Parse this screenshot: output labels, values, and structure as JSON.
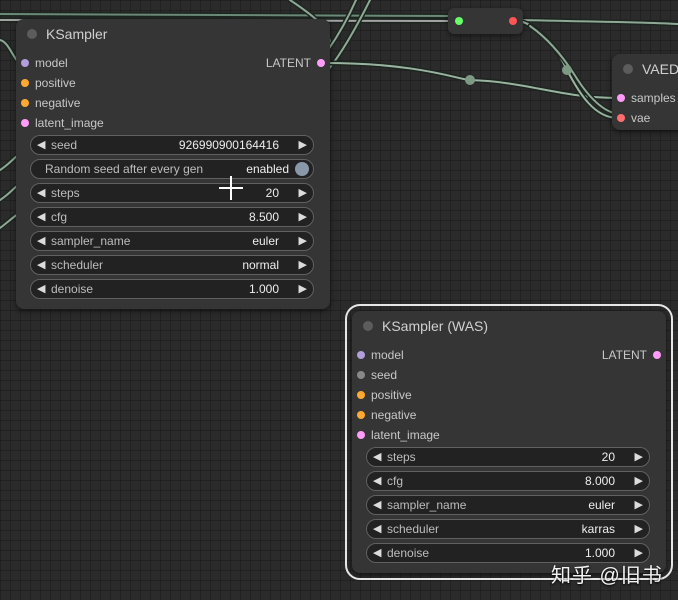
{
  "colors": {
    "model": "#b39ddb",
    "clip": "#ffd500",
    "conditioning": "#ffa931",
    "latent": "#ff9cf9",
    "vae": "#ff6e6e",
    "seed": "#888888",
    "reroute_in": "#66ff66",
    "reroute_out": "#ff5555"
  },
  "ksampler": {
    "title": "KSampler",
    "inputs": [
      "model",
      "positive",
      "negative",
      "latent_image"
    ],
    "output": "LATENT",
    "widgets": {
      "seed": {
        "label": "seed",
        "value": "926990900164416"
      },
      "random_seed": {
        "label": "Random seed after every gen",
        "value": "enabled"
      },
      "steps": {
        "label": "steps",
        "value": "20"
      },
      "cfg": {
        "label": "cfg",
        "value": "8.500"
      },
      "sampler_name": {
        "label": "sampler_name",
        "value": "euler"
      },
      "scheduler": {
        "label": "scheduler",
        "value": "normal"
      },
      "denoise": {
        "label": "denoise",
        "value": "1.000"
      }
    }
  },
  "vae_decode": {
    "title": "VAED",
    "inputs": [
      "samples",
      "vae"
    ]
  },
  "ksampler_was": {
    "title": "KSampler (WAS)",
    "inputs": [
      "model",
      "seed",
      "positive",
      "negative",
      "latent_image"
    ],
    "output": "LATENT",
    "widgets": {
      "steps": {
        "label": "steps",
        "value": "20"
      },
      "cfg": {
        "label": "cfg",
        "value": "8.000"
      },
      "sampler_name": {
        "label": "sampler_name",
        "value": "euler"
      },
      "scheduler": {
        "label": "scheduler",
        "value": "karras"
      },
      "denoise": {
        "label": "denoise",
        "value": "1.000"
      }
    }
  },
  "watermark": "知乎 @旧书"
}
